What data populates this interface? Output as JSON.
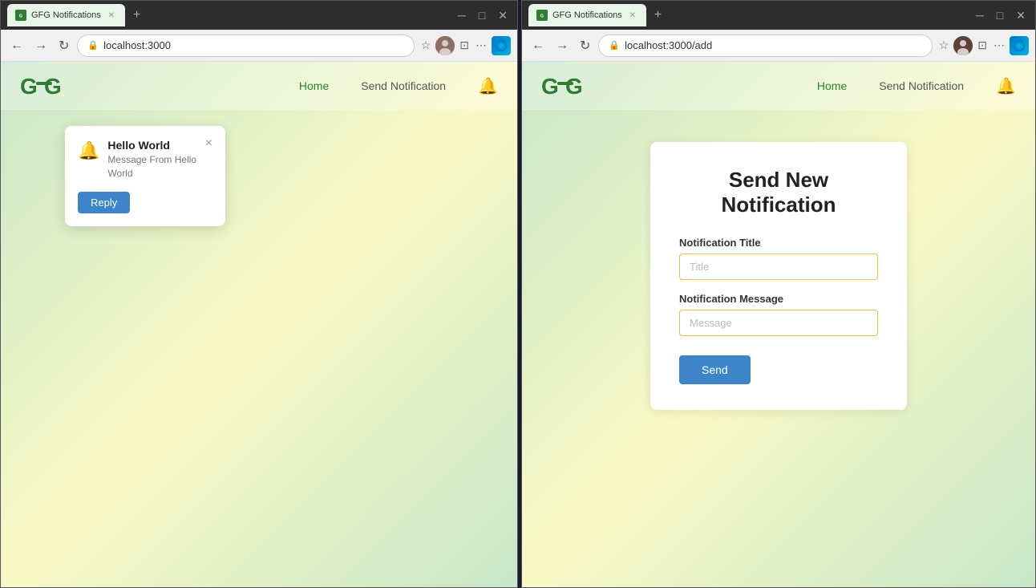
{
  "browser1": {
    "tab_title": "GFG Notifications",
    "url": "localhost:3000",
    "nav": {
      "home_label": "Home",
      "send_label": "Send Notification"
    },
    "notification": {
      "title": "Hello World",
      "message": "Message From Hello World",
      "reply_label": "Reply",
      "close_label": "×"
    }
  },
  "browser2": {
    "tab_title": "GFG Notifications",
    "url": "localhost:3000/add",
    "nav": {
      "home_label": "Home",
      "send_label": "Send Notification"
    },
    "form": {
      "page_title": "Send New Notification",
      "title_label": "Notification Title",
      "title_placeholder": "Title",
      "message_label": "Notification Message",
      "message_placeholder": "Message",
      "send_label": "Send"
    }
  },
  "icons": {
    "bell": "🔔",
    "close": "✕",
    "back": "←",
    "forward": "→",
    "refresh": "↻",
    "lock": "🔒",
    "star": "☆",
    "split": "⊡",
    "more": "⋯",
    "minimize": "─",
    "maximize": "□",
    "window_close": "✕"
  }
}
